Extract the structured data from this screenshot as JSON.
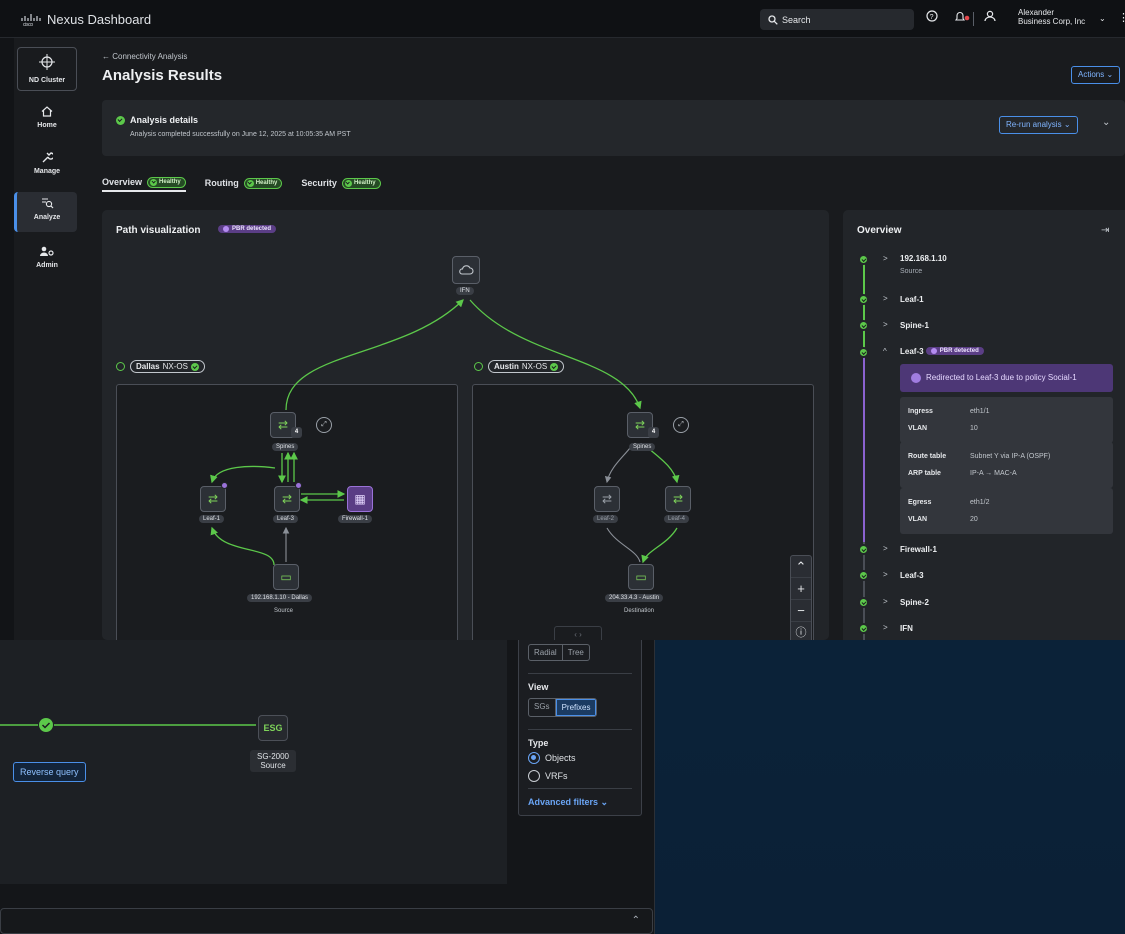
{
  "app": {
    "brand_mark": "cisco",
    "title": "Nexus Dashboard"
  },
  "topbar": {
    "search_label": "Search",
    "user_name": "Alexander",
    "user_org": "Business Corp, Inc"
  },
  "sidebar": {
    "cluster": "ND Cluster",
    "items": [
      {
        "label": "Home",
        "icon": "home-icon"
      },
      {
        "label": "Manage",
        "icon": "wrench-icon"
      },
      {
        "label": "Analyze",
        "icon": "analyze-icon",
        "active": true
      },
      {
        "label": "Admin",
        "icon": "admin-icon"
      }
    ]
  },
  "page": {
    "breadcrumb": "← Connectivity Analysis",
    "title": "Analysis Results",
    "actions_label": "Actions"
  },
  "details": {
    "title": "Analysis details",
    "subtitle": "Analysis completed successfully on June 12, 2025 at 10:05:35 AM PST",
    "rerun_label": "Re-run analysis"
  },
  "tabs": [
    {
      "label": "Overview",
      "badge": "Healthy",
      "active": true
    },
    {
      "label": "Routing",
      "badge": "Healthy"
    },
    {
      "label": "Security",
      "badge": "Healthy"
    }
  ],
  "viz": {
    "title": "Path visualization",
    "pbr_badge": "PBR detected",
    "ifn_label": "IFN",
    "site1": {
      "name": "Dallas",
      "os": "NX-OS"
    },
    "site2": {
      "name": "Austin",
      "os": "NX-OS"
    },
    "dallas": {
      "spines": "Spines",
      "spine_count": "4",
      "leaf1": "Leaf-1",
      "leaf3": "Leaf-3",
      "firewall": "Firewall-1",
      "source_ip": "192.168.1.10 - Dallas",
      "source_role": "Source"
    },
    "austin": {
      "spines": "Spines",
      "spine_count": "4",
      "leaf2": "Leaf-2",
      "leaf4": "Leaf-4",
      "dest_ip": "204.33.4.3 - Austin",
      "dest_role": "Destination"
    },
    "colors": {
      "path": "#5cc84a",
      "pbr": "#9a72d8",
      "inactive": "#8a8f97"
    }
  },
  "overview": {
    "title": "Overview",
    "steps": [
      {
        "name": "192.168.1.10",
        "sub": "Source"
      },
      {
        "name": "Leaf-1"
      },
      {
        "name": "Spine-1"
      },
      {
        "name": "Leaf-3",
        "badge": "PBR detected",
        "expanded": true
      },
      {
        "name": "Firewall-1"
      },
      {
        "name": "Leaf-3"
      },
      {
        "name": "Spine-2"
      },
      {
        "name": "IFN"
      }
    ],
    "redirect": "Redirected to Leaf-3 due to policy Social-1",
    "groups": [
      [
        {
          "k": "Ingress",
          "v": "eth1/1"
        },
        {
          "k": "VLAN",
          "v": "10"
        }
      ],
      [
        {
          "k": "Route table",
          "v": "Subnet Y via IP-A (OSPF)"
        },
        {
          "k": "ARP table",
          "v": "IP-A → MAC-A"
        }
      ],
      [
        {
          "k": "Egress",
          "v": "eth1/2"
        },
        {
          "k": "VLAN",
          "v": "20"
        }
      ]
    ]
  },
  "background": {
    "layout_labels": [
      "Radial",
      "Tree"
    ],
    "view_title": "View",
    "view_options": [
      "SGs",
      "Prefixes"
    ],
    "type_title": "Type",
    "type_options": [
      "Objects",
      "VRFs"
    ],
    "advanced_filters": "Advanced filters",
    "reverse_query": "Reverse query",
    "esg_label": "ESG",
    "esg_name": "SG-2000",
    "esg_role": "Source"
  }
}
